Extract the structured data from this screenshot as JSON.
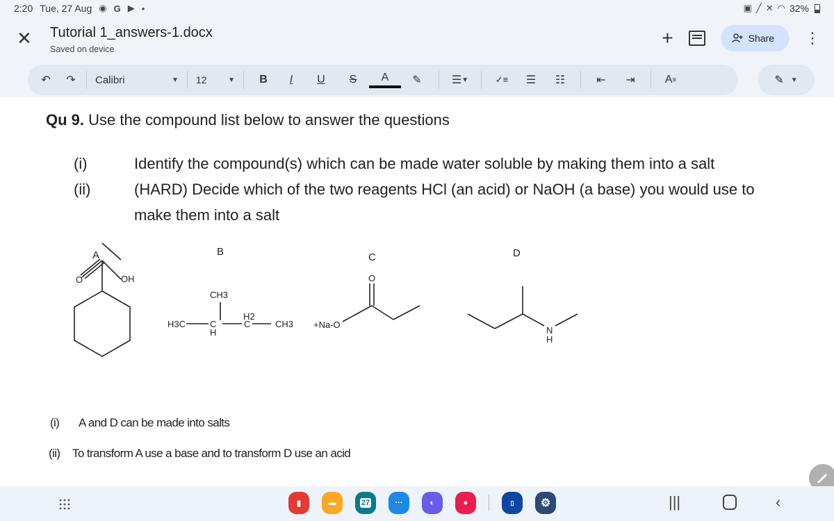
{
  "status_bar": {
    "time": "2:20",
    "date": "Tue, 27 Aug",
    "notification_icons": [
      "chrome-icon",
      "google-icon",
      "youtube-icon"
    ],
    "battery": "32%"
  },
  "app_bar": {
    "title": "Tutorial 1_answers-1.docx",
    "subtitle": "Saved on device",
    "share_label": "Share"
  },
  "toolbar": {
    "font": "Calibri",
    "font_size": "12",
    "bold": "B",
    "italic": "I",
    "underline": "U",
    "text_color": "A",
    "text_style": "A"
  },
  "document": {
    "question_label": "Qu 9.",
    "question_text": " Use the compound list below to answer the questions",
    "items": [
      {
        "num": "(i)",
        "text": "Identify the compound(s) which can be made water soluble by making them into a salt"
      },
      {
        "num": "(ii)",
        "text": "(HARD) Decide which of the two reagents HCl (an acid) or NaOH (a base) you would use to",
        "text2": "make them into a salt"
      }
    ],
    "compounds": {
      "A": {
        "label": "A",
        "atoms": [
          "O",
          "OH"
        ]
      },
      "B": {
        "label": "B",
        "atoms": [
          "CH3",
          "H3C",
          "C",
          "H",
          "H2",
          "C",
          "CH3"
        ]
      },
      "C": {
        "label": "C",
        "atoms": [
          "O",
          "+Na-O"
        ]
      },
      "D": {
        "label": "D",
        "atoms": [
          "N",
          "H"
        ]
      }
    },
    "answers": [
      {
        "num": "(i)",
        "text": "A and D can be made into salts"
      },
      {
        "num": "(ii)",
        "text": "To transform A use a base and to transform D use an acid"
      }
    ]
  },
  "dock": {
    "calendar_day": "27",
    "apps": [
      "notes-app",
      "files-app",
      "calendar-app",
      "messages-app",
      "internet-app",
      "camera-app",
      "university-app",
      "settings-app"
    ]
  },
  "colors": {
    "share_bg": "#d3e3fd",
    "toolbar_bg": "#e2e8f0",
    "background": "#f0f4f9"
  }
}
